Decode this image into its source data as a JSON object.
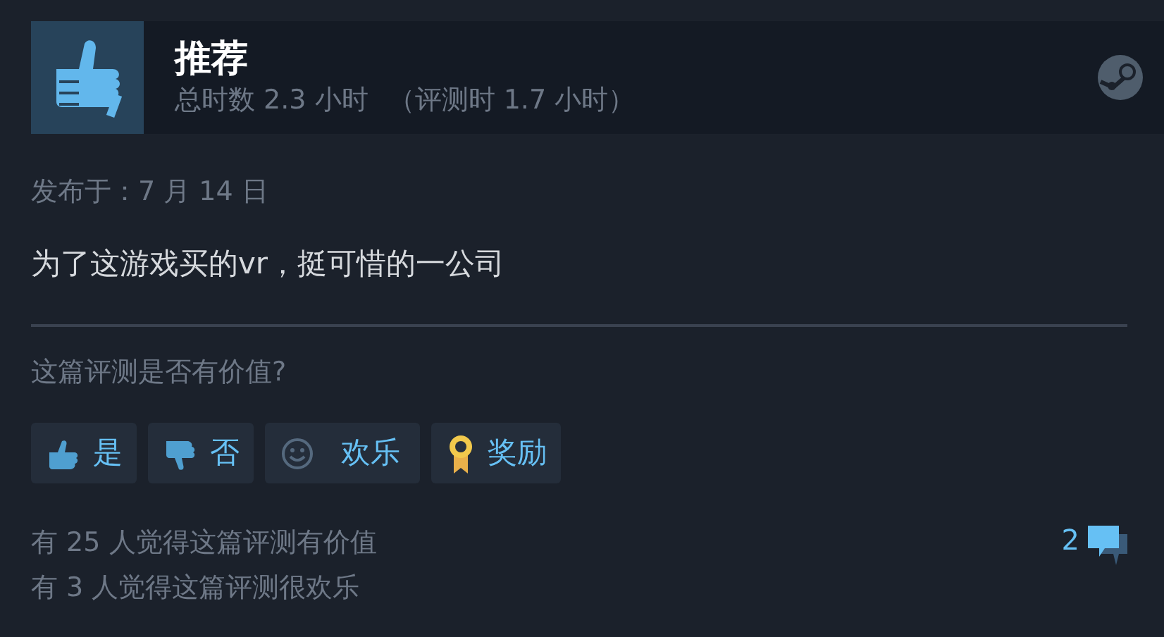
{
  "header": {
    "verdict": "推荐",
    "hours": "总时数 2.3 小时",
    "hours_at_review": "（评测时 1.7 小时）"
  },
  "posted": "发布于：7 月 14 日",
  "review_text": "为了这游戏买的vr，挺可惜的一公司",
  "helpful_prompt": "这篇评测是否有价值?",
  "buttons": [
    {
      "kind": "yes",
      "label": "是"
    },
    {
      "kind": "no",
      "label": "否"
    },
    {
      "kind": "funny",
      "label": "欢乐"
    },
    {
      "kind": "award",
      "label": "奖励"
    }
  ],
  "stats": [
    "有 25 人觉得这篇评测有价值",
    "有 3 人觉得这篇评测很欢乐"
  ],
  "comment_count": "2"
}
